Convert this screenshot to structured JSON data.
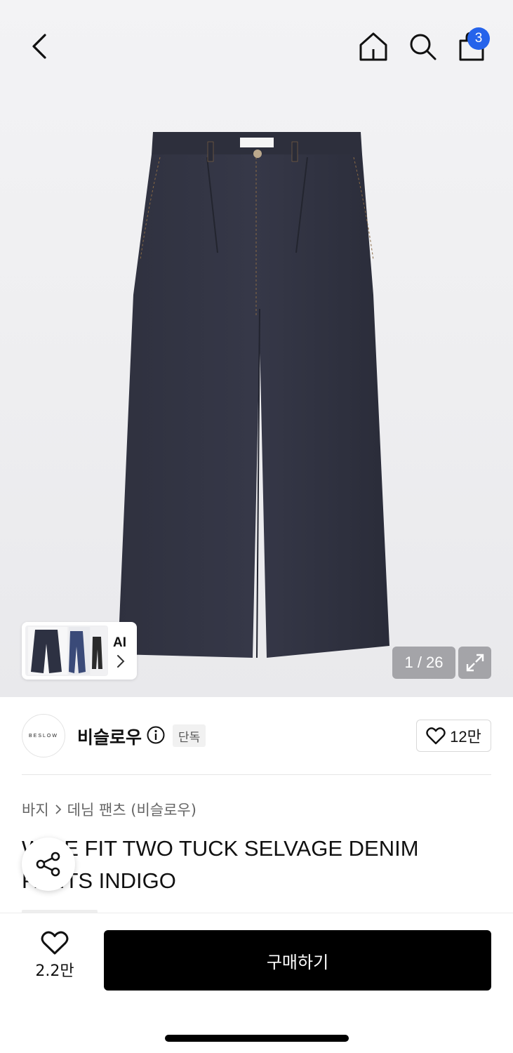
{
  "header": {
    "cart_count": "3",
    "icons": [
      "back-icon",
      "home-icon",
      "search-icon",
      "cart-icon"
    ]
  },
  "gallery": {
    "counter": "1 / 26",
    "ai_label": "AI",
    "product_color": "#2b2d3a"
  },
  "brand": {
    "logo_text": "BESLOW",
    "name": "비슬로우",
    "badge": "단독",
    "likes": "12만"
  },
  "breadcrumb": {
    "category": "바지",
    "subcategory": "데님 팬츠 (비슬로우)"
  },
  "product": {
    "title": "WIDE FIT TWO TUCK SELVAGE DENIM PANTS INDIGO"
  },
  "bottom_bar": {
    "wish_count": "2.2만",
    "buy_label": "구매하기"
  },
  "colors": {
    "accent_badge": "#2563eb",
    "buy_button": "#000000"
  }
}
